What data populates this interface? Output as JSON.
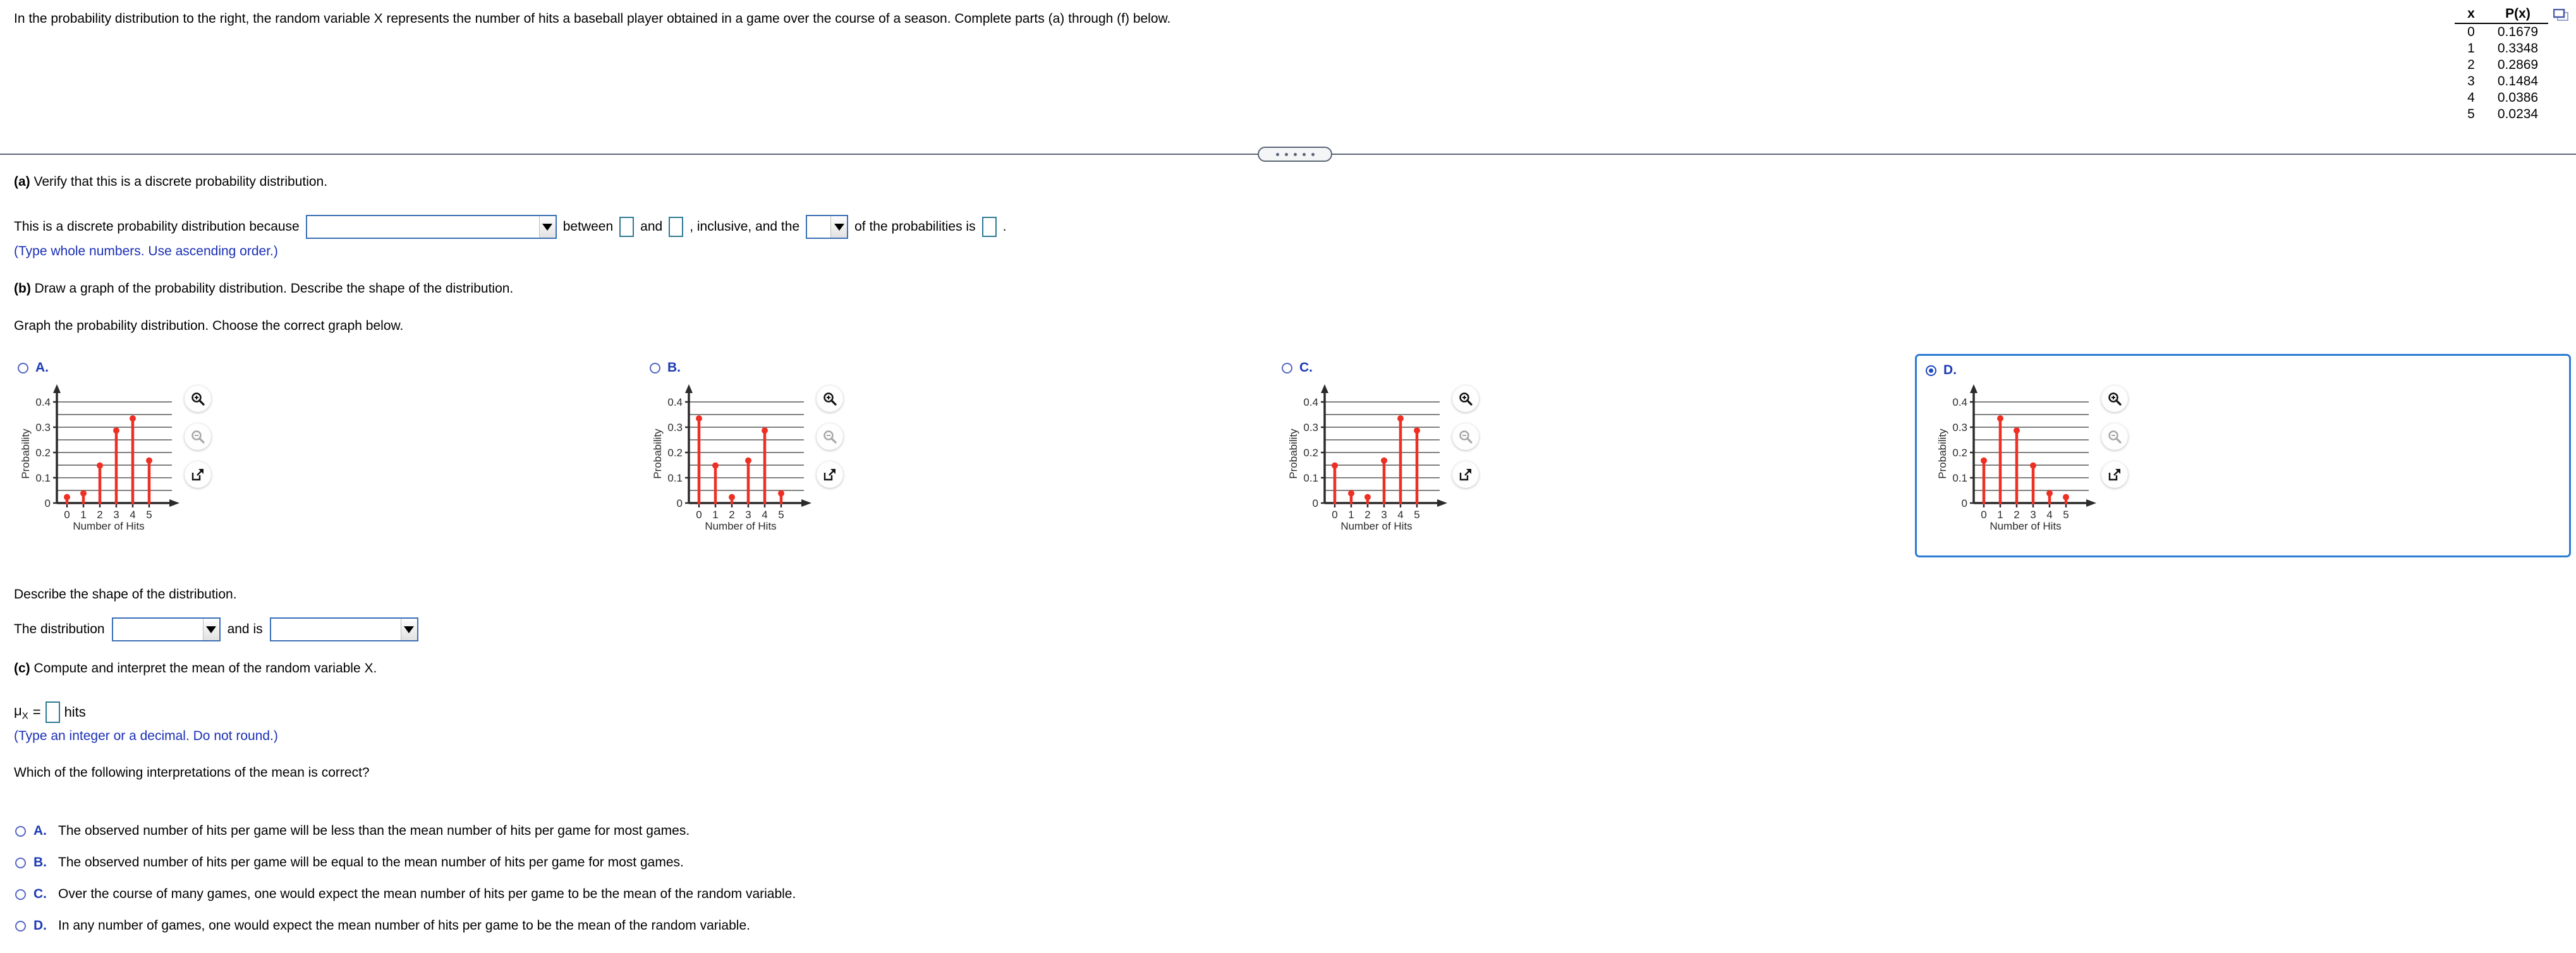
{
  "question": {
    "prompt": "In the probability distribution to the right, the random variable X represents the number of hits a baseball player obtained in a game over the course of a season. Complete parts (a) through (f) below."
  },
  "prob_table": {
    "headers": [
      "x",
      "P(x)"
    ],
    "rows": [
      {
        "x": "0",
        "p": "0.1679"
      },
      {
        "x": "1",
        "p": "0.3348"
      },
      {
        "x": "2",
        "p": "0.2869"
      },
      {
        "x": "3",
        "p": "0.1484"
      },
      {
        "x": "4",
        "p": "0.0386"
      },
      {
        "x": "5",
        "p": "0.0234"
      }
    ],
    "popout_icon": "popout-windows-icon"
  },
  "splitter": {
    "handle_dots": 5
  },
  "part_a": {
    "label": "(a)",
    "text": "Verify that this is a discrete probability distribution.",
    "sentence_1": "This is a discrete probability distribution because",
    "dropdown_1_value": "",
    "sentence_2": "between",
    "input_1_value": "",
    "sentence_3": "and",
    "input_2_value": "",
    "sentence_4": ", inclusive, and the",
    "dropdown_2_value": "",
    "sentence_5": "of the probabilities is",
    "input_3_value": "",
    "sentence_6": ".",
    "hint": "(Type whole numbers. Use ascending order.)"
  },
  "part_b": {
    "label": "(b)",
    "text": "Draw a graph of the probability distribution. Describe the shape of the distribution.",
    "instruction": "Graph the probability distribution. Choose the correct graph below.",
    "options": [
      {
        "letter": "A.",
        "selected": false
      },
      {
        "letter": "B.",
        "selected": false
      },
      {
        "letter": "C.",
        "selected": false
      },
      {
        "letter": "D.",
        "selected": true
      }
    ],
    "shape_prompt": "Describe the shape of the distribution.",
    "shape_sentence_1": "The distribution",
    "shape_dropdown_1_value": "",
    "shape_sentence_2": "and is",
    "shape_dropdown_2_value": ""
  },
  "part_c": {
    "label": "(c)",
    "text": "Compute and interpret the mean of the random variable X.",
    "mu_symbol": "μ",
    "mu_subscript": "X",
    "mu_equals": "=",
    "mu_value": "",
    "mu_units": "hits",
    "hint": "(Type an integer or a decimal. Do not round.)",
    "interpretation_prompt": "Which of the following interpretations of the mean is correct?",
    "answers": [
      {
        "letter": "A.",
        "text": "The observed number of hits per game will be less than the mean number of hits per game for most games.",
        "selected": false
      },
      {
        "letter": "B.",
        "text": "The observed number of hits per game will be equal to the mean number of hits per game for most games.",
        "selected": false
      },
      {
        "letter": "C.",
        "text": "Over the course of many games, one would expect the mean number of hits per game to be the mean of the random variable.",
        "selected": false
      },
      {
        "letter": "D.",
        "text": "In any number of games, one would expect the mean number of hits per game to be the mean of the random variable.",
        "selected": false
      }
    ]
  },
  "graph_icons": {
    "zoom_in": "zoom-in-icon",
    "zoom_out": "zoom-out-icon",
    "popout": "popout-icon"
  },
  "colors": {
    "stem_red": "#ee2f24",
    "option_blue": "#1d3bb5",
    "selected_border": "#2a7bd4",
    "hint_blue": "#1a2fb5",
    "grid_gray": "#808080"
  },
  "chart_data": [
    {
      "type": "scatter",
      "option": "A",
      "title": "",
      "xlabel": "Number of Hits",
      "ylabel": "Probability",
      "categories": [
        0,
        1,
        2,
        3,
        4,
        5
      ],
      "values": [
        0.0234,
        0.0386,
        0.1484,
        0.2869,
        0.3348,
        0.1679
      ],
      "xtick_labels": [
        "0",
        "1",
        "2",
        "3",
        "4",
        "5"
      ],
      "ytick_labels": [
        "0",
        "0.1",
        "0.2",
        "0.3",
        "0.4"
      ],
      "yticks": [
        0,
        0.1,
        0.2,
        0.3,
        0.4
      ],
      "ylim": [
        0,
        0.45
      ],
      "gridlines": [
        0.05,
        0.1,
        0.15,
        0.2,
        0.25,
        0.3,
        0.35,
        0.4
      ],
      "grid": true,
      "legend": "none"
    },
    {
      "type": "scatter",
      "option": "B",
      "title": "",
      "xlabel": "Number of Hits",
      "ylabel": "Probability",
      "categories": [
        0,
        1,
        2,
        3,
        4,
        5
      ],
      "values": [
        0.3348,
        0.1484,
        0.0234,
        0.1679,
        0.2869,
        0.0386
      ],
      "xtick_labels": [
        "0",
        "1",
        "2",
        "3",
        "4",
        "5"
      ],
      "ytick_labels": [
        "0",
        "0.1",
        "0.2",
        "0.3",
        "0.4"
      ],
      "yticks": [
        0,
        0.1,
        0.2,
        0.3,
        0.4
      ],
      "ylim": [
        0,
        0.45
      ],
      "gridlines": [
        0.05,
        0.1,
        0.15,
        0.2,
        0.25,
        0.3,
        0.35,
        0.4
      ],
      "grid": true,
      "legend": "none"
    },
    {
      "type": "scatter",
      "option": "C",
      "title": "",
      "xlabel": "Number of Hits",
      "ylabel": "Probability",
      "categories": [
        0,
        1,
        2,
        3,
        4,
        5
      ],
      "values": [
        0.1484,
        0.0386,
        0.0234,
        0.1679,
        0.3348,
        0.2869
      ],
      "xtick_labels": [
        "0",
        "1",
        "2",
        "3",
        "4",
        "5"
      ],
      "ytick_labels": [
        "0",
        "0.1",
        "0.2",
        "0.3",
        "0.4"
      ],
      "yticks": [
        0,
        0.1,
        0.2,
        0.3,
        0.4
      ],
      "ylim": [
        0,
        0.45
      ],
      "gridlines": [
        0.05,
        0.1,
        0.15,
        0.2,
        0.25,
        0.3,
        0.35,
        0.4
      ],
      "grid": true,
      "legend": "none"
    },
    {
      "type": "scatter",
      "option": "D",
      "title": "",
      "xlabel": "Number of Hits",
      "ylabel": "Probability",
      "categories": [
        0,
        1,
        2,
        3,
        4,
        5
      ],
      "values": [
        0.1679,
        0.3348,
        0.2869,
        0.1484,
        0.0386,
        0.0234
      ],
      "xtick_labels": [
        "0",
        "1",
        "2",
        "3",
        "4",
        "5"
      ],
      "ytick_labels": [
        "0",
        "0.1",
        "0.2",
        "0.3",
        "0.4"
      ],
      "yticks": [
        0,
        0.1,
        0.2,
        0.3,
        0.4
      ],
      "ylim": [
        0,
        0.45
      ],
      "gridlines": [
        0.05,
        0.1,
        0.15,
        0.2,
        0.25,
        0.3,
        0.35,
        0.4
      ],
      "grid": true,
      "legend": "none"
    }
  ]
}
